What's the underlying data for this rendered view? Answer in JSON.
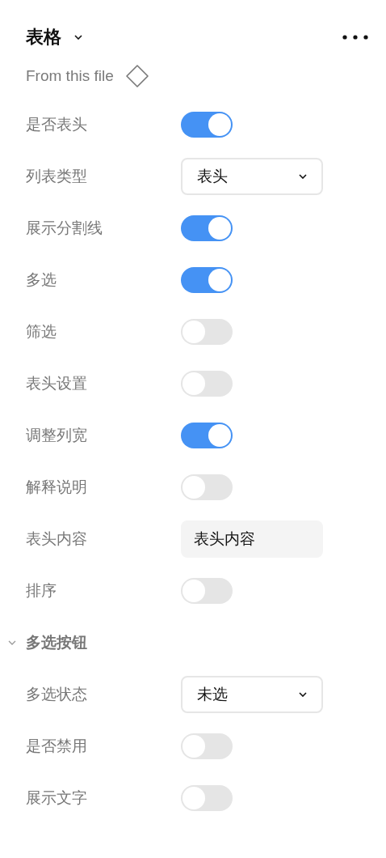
{
  "header": {
    "title": "表格",
    "source": "From this file"
  },
  "properties": [
    {
      "label": "是否表头",
      "kind": "toggle",
      "on": true
    },
    {
      "label": "列表类型",
      "kind": "select",
      "value": "表头"
    },
    {
      "label": "展示分割线",
      "kind": "toggle",
      "on": true
    },
    {
      "label": "多选",
      "kind": "toggle",
      "on": true
    },
    {
      "label": "筛选",
      "kind": "toggle",
      "on": false
    },
    {
      "label": "表头设置",
      "kind": "toggle",
      "on": false
    },
    {
      "label": "调整列宽",
      "kind": "toggle",
      "on": true
    },
    {
      "label": "解释说明",
      "kind": "toggle",
      "on": false
    },
    {
      "label": "表头内容",
      "kind": "text",
      "value": "表头内容"
    },
    {
      "label": "排序",
      "kind": "toggle",
      "on": false
    }
  ],
  "section": {
    "title": "多选按钮",
    "expanded": true,
    "properties": [
      {
        "label": "多选状态",
        "kind": "select",
        "value": "未选"
      },
      {
        "label": "是否禁用",
        "kind": "toggle",
        "on": false
      },
      {
        "label": "展示文字",
        "kind": "toggle",
        "on": false
      }
    ]
  }
}
